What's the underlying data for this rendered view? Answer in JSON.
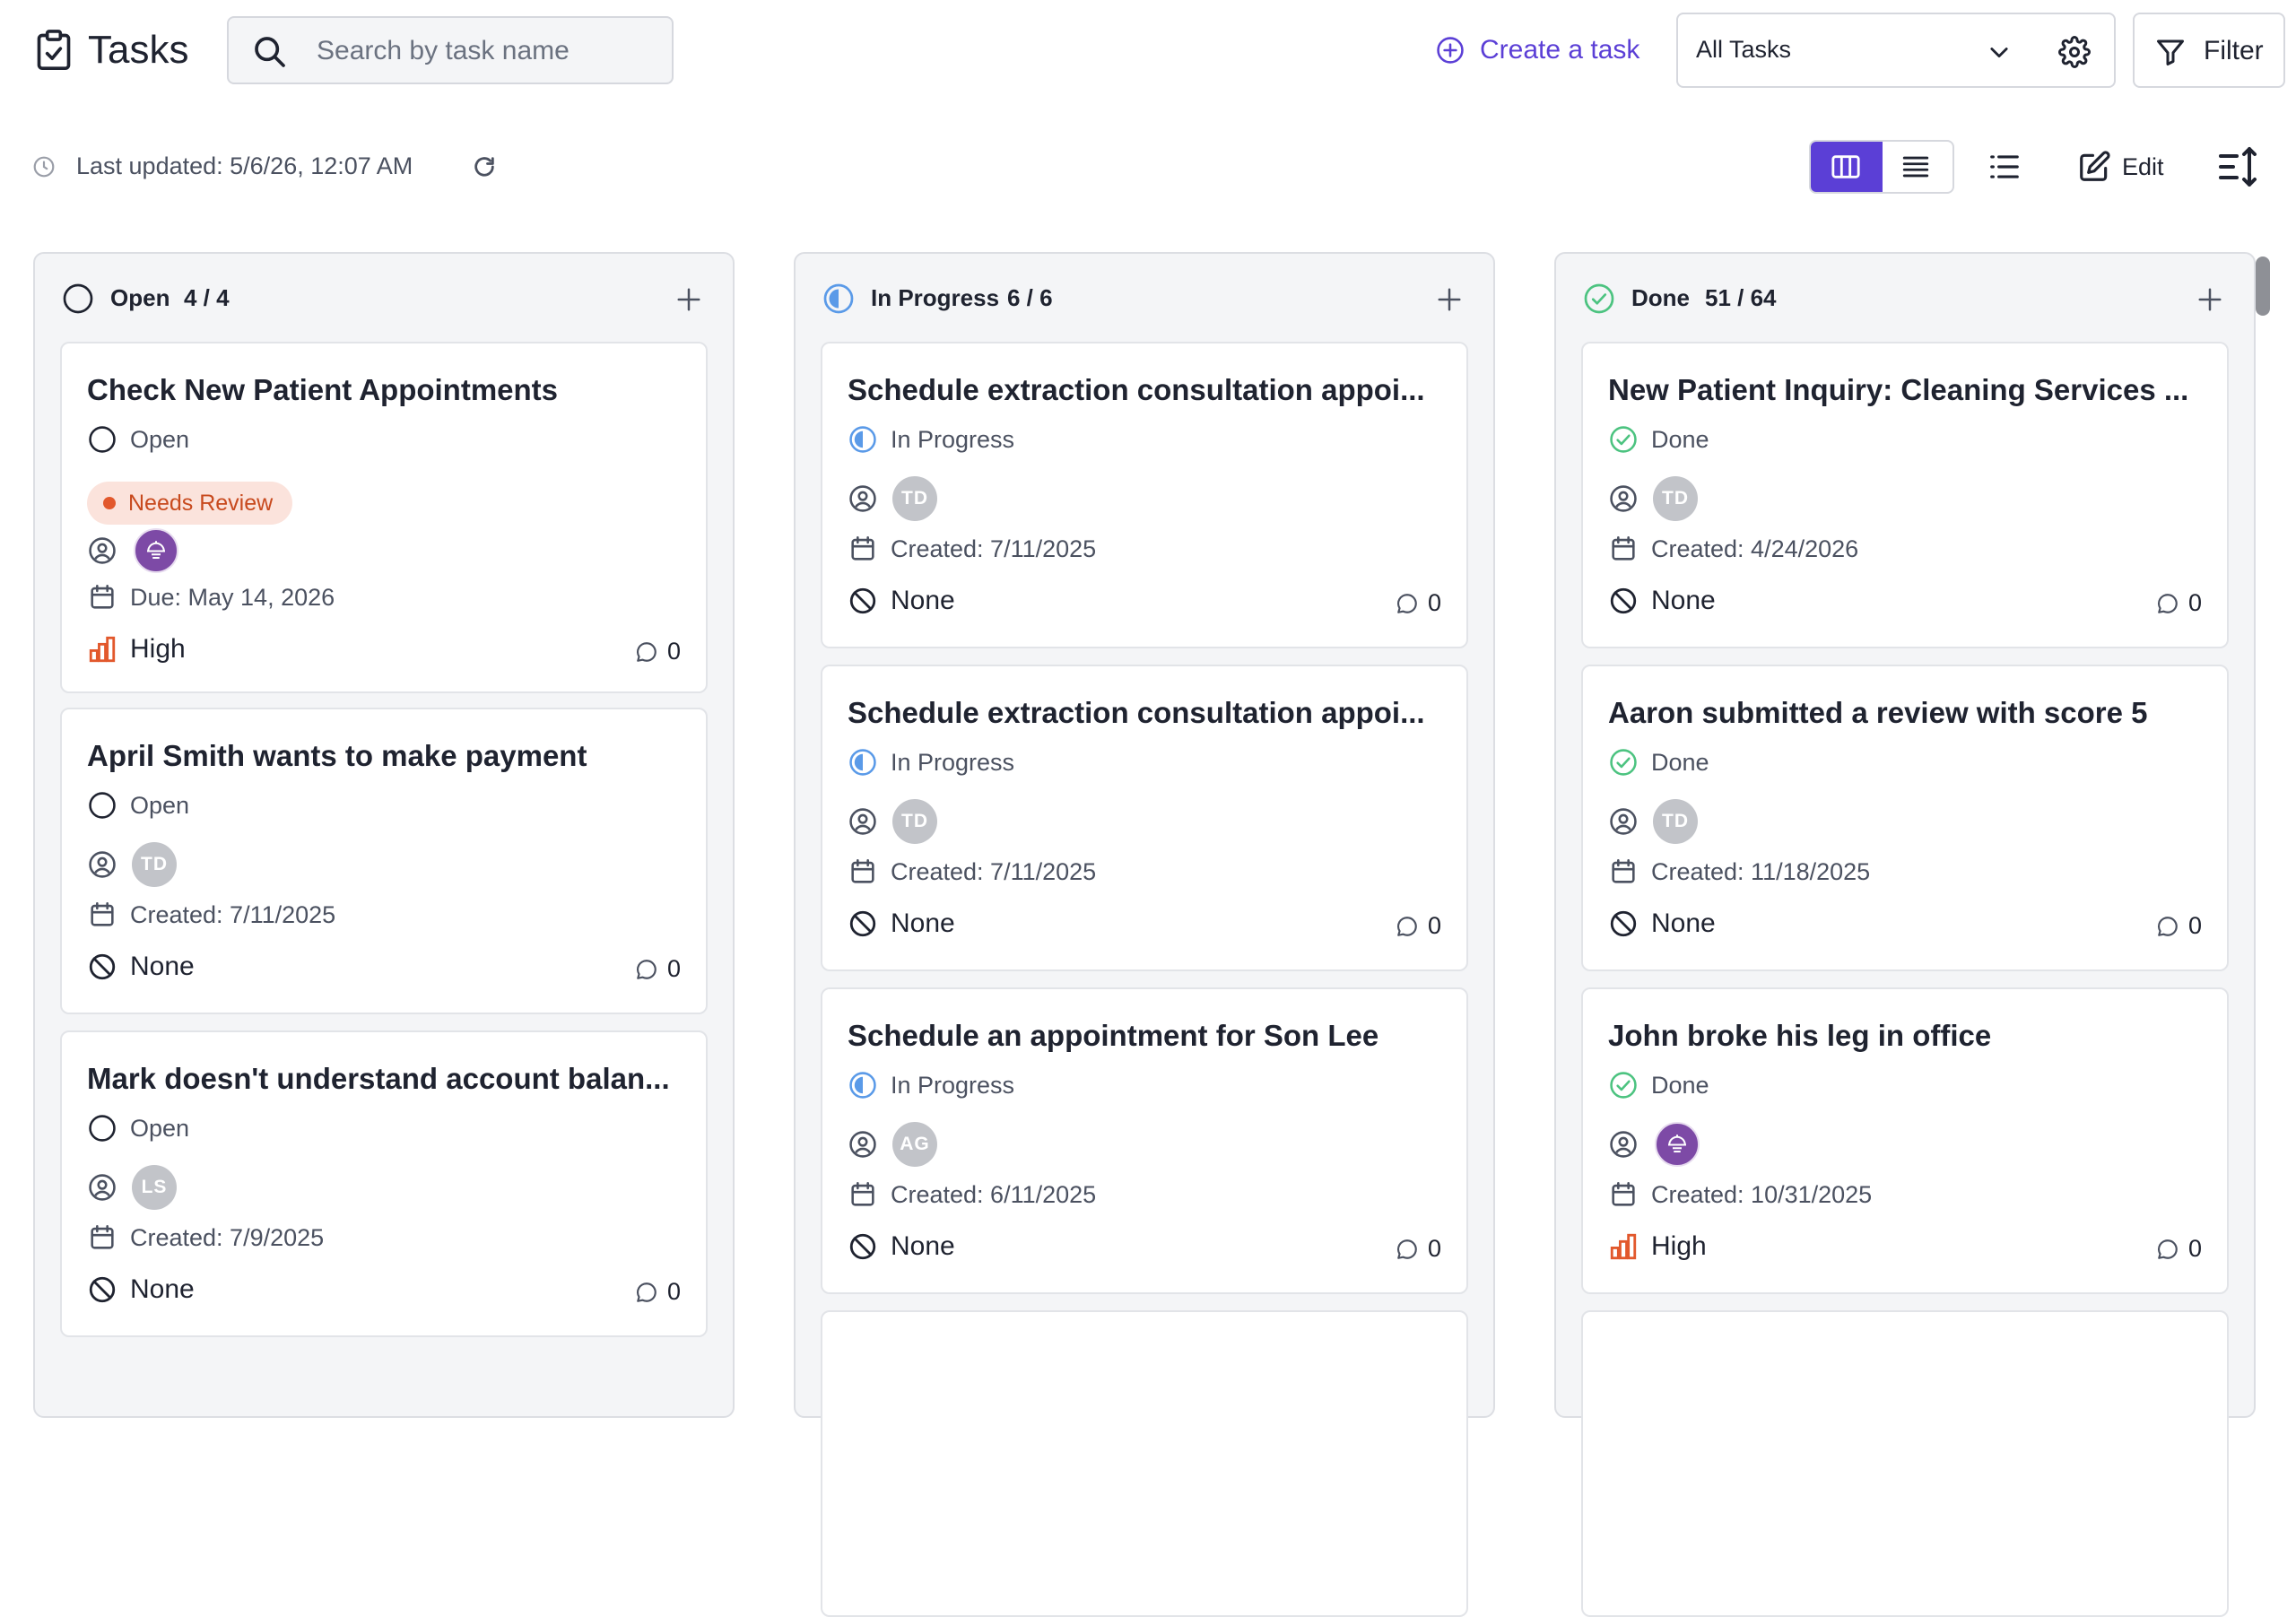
{
  "header": {
    "title": "Tasks",
    "search_placeholder": "Search by task name",
    "create_label": "Create a task",
    "view_select": "All Tasks",
    "filter_label": "Filter"
  },
  "subheader": {
    "last_updated": "Last updated: 5/6/26, 12:07 AM",
    "edit_label": "Edit"
  },
  "colors": {
    "accent": "#5b3fd6",
    "in_progress": "#5a9ae8",
    "done": "#4cc380",
    "priority_high": "#e2582c"
  },
  "columns": [
    {
      "name": "Open",
      "count": "4 / 4",
      "cards": [
        {
          "title": "Check New Patient Appointments",
          "status": "Open",
          "badge": "Needs Review",
          "assignee": "logo",
          "date": "Due: May 14, 2026",
          "priority": "High",
          "comments": "0"
        },
        {
          "title": "April Smith wants to make payment",
          "status": "Open",
          "assignee": "TD",
          "date": "Created: 7/11/2025",
          "priority": "None",
          "comments": "0"
        },
        {
          "title": "Mark doesn't understand account balan...",
          "status": "Open",
          "assignee": "LS",
          "date": "Created: 7/9/2025",
          "priority": "None",
          "comments": "0"
        }
      ]
    },
    {
      "name": "In Progress",
      "count": "6 / 6",
      "cards": [
        {
          "title": "Schedule extraction consultation appoi...",
          "status": "In Progress",
          "assignee": "TD",
          "date": "Created: 7/11/2025",
          "priority": "None",
          "comments": "0"
        },
        {
          "title": "Schedule extraction consultation appoi...",
          "status": "In Progress",
          "assignee": "TD",
          "date": "Created: 7/11/2025",
          "priority": "None",
          "comments": "0"
        },
        {
          "title": "Schedule an appointment for Son Lee",
          "status": "In Progress",
          "assignee": "AG",
          "date": "Created: 6/11/2025",
          "priority": "None",
          "comments": "0"
        }
      ]
    },
    {
      "name": "Done",
      "count": "51 / 64",
      "cards": [
        {
          "title": "New Patient Inquiry: Cleaning Services ...",
          "status": "Done",
          "assignee": "TD",
          "date": "Created: 4/24/2026",
          "priority": "None",
          "comments": "0"
        },
        {
          "title": "Aaron submitted a review with score 5",
          "status": "Done",
          "assignee": "TD",
          "date": "Created: 11/18/2025",
          "priority": "None",
          "comments": "0"
        },
        {
          "title": "John broke his leg in office",
          "status": "Done",
          "assignee": "logo",
          "date": "Created: 10/31/2025",
          "priority": "High",
          "comments": "0"
        }
      ]
    }
  ]
}
